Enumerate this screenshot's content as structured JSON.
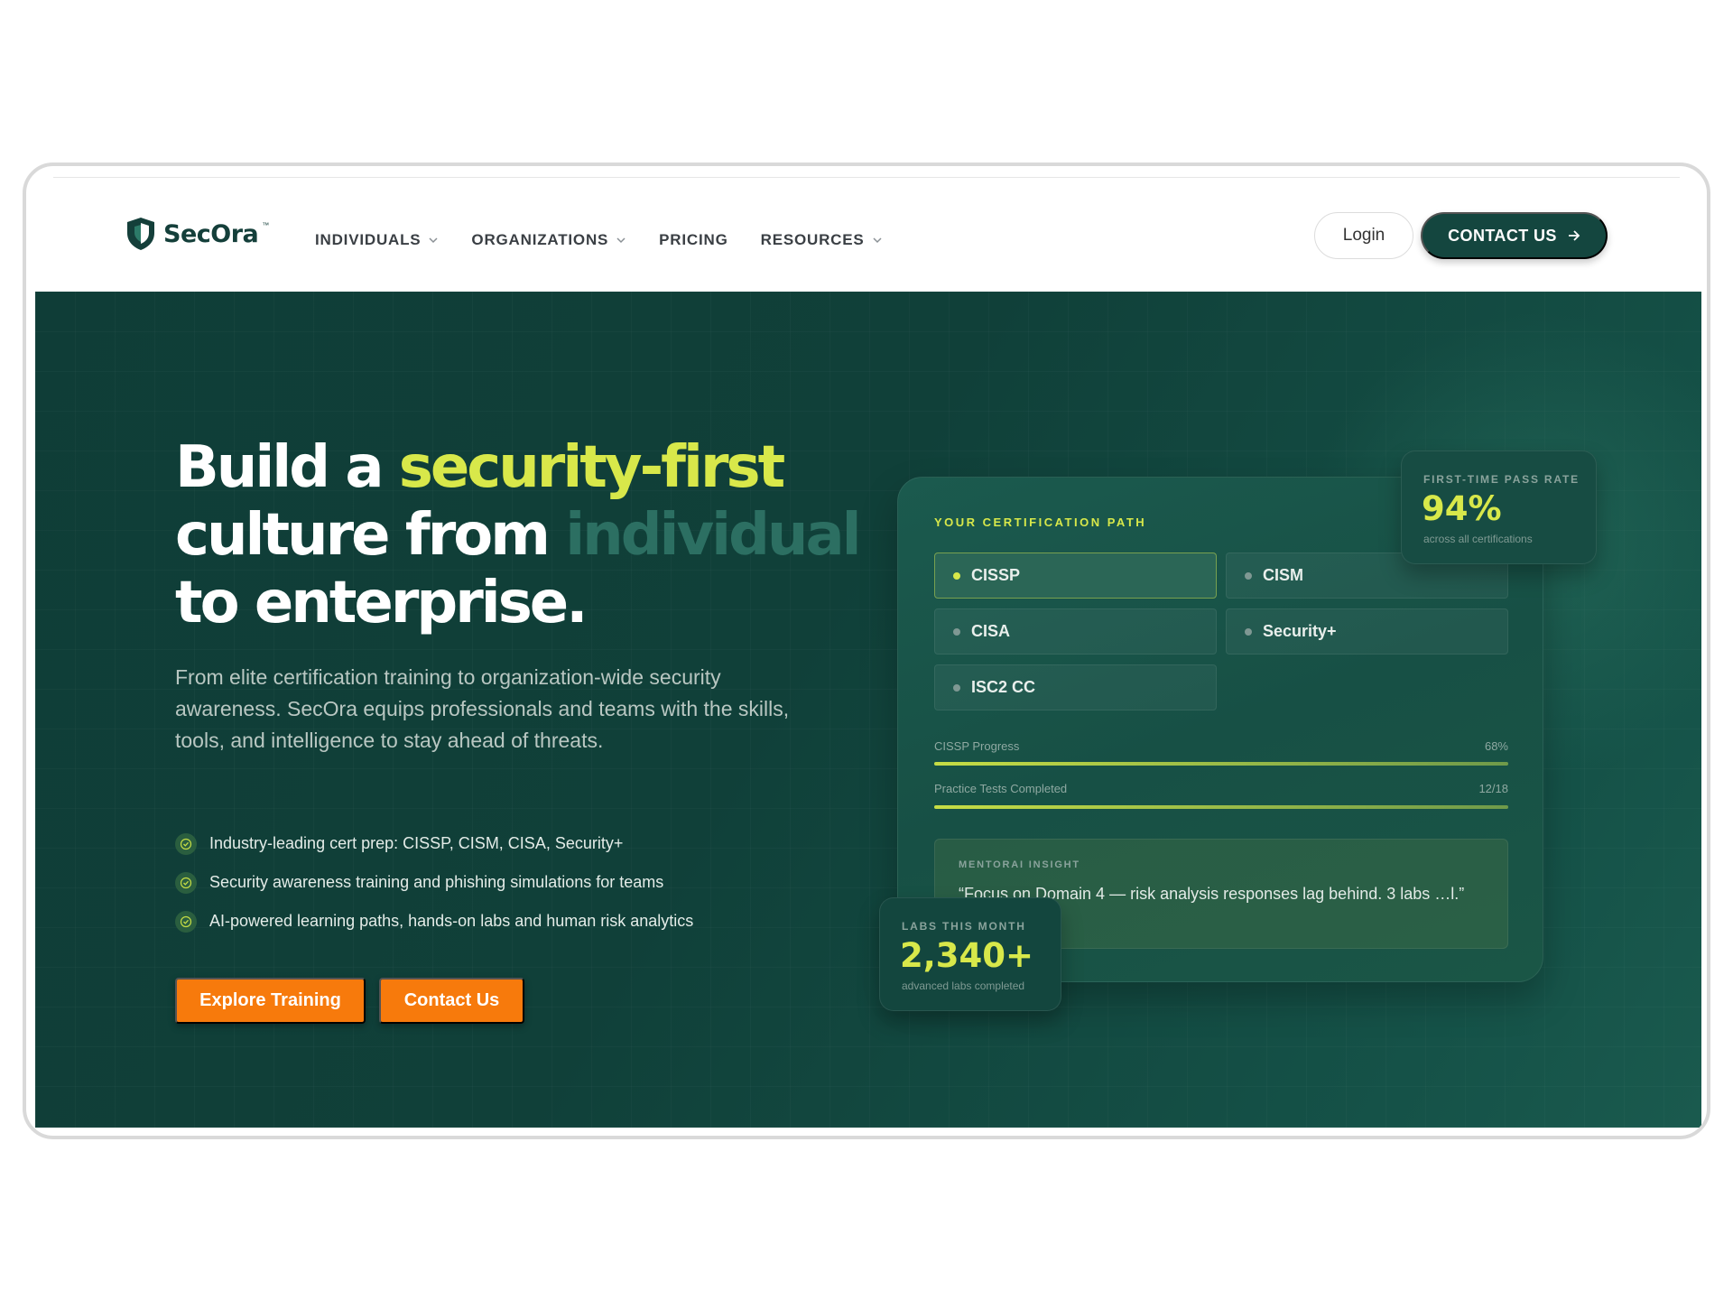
{
  "brand": {
    "name": "SecOra",
    "trademark": "™"
  },
  "nav": {
    "items": [
      {
        "label": "INDIVIDUALS",
        "has_dropdown": true
      },
      {
        "label": "ORGANIZATIONS",
        "has_dropdown": true
      },
      {
        "label": "PRICING",
        "has_dropdown": false
      },
      {
        "label": "RESOURCES",
        "has_dropdown": true
      }
    ],
    "login_label": "Login",
    "contact_label": "CONTACT US"
  },
  "hero": {
    "headline_part1": "Build a ",
    "headline_highlight": "security-first",
    "headline_part2": "culture from ",
    "headline_dim": "individual",
    "headline_part3": "to enterprise.",
    "subtitle": "From elite certification training to organization-wide security awareness. SecOra equips professionals and teams with the skills, tools, and intelligence to stay ahead of threats.",
    "features": [
      "Industry-leading cert prep: CISSP, CISM, CISA, Security+",
      "Security awareness training and phishing simulations for teams",
      "AI-powered learning paths, hands-on labs and human risk analytics"
    ],
    "cta_primary": "Explore Training",
    "cta_secondary": "Contact Us"
  },
  "dashboard": {
    "title": "YOUR CERTIFICATION PATH",
    "certs": [
      {
        "label": "CISSP",
        "active": true
      },
      {
        "label": "CISM",
        "active": false
      },
      {
        "label": "CISA",
        "active": false
      },
      {
        "label": "Security+",
        "active": false
      },
      {
        "label": "ISC2 CC",
        "active": false
      }
    ],
    "progress": [
      {
        "label": "CISSP Progress",
        "value_text": "68%",
        "fraction": 1.0
      },
      {
        "label": "Practice Tests Completed",
        "value_text": "12/18",
        "fraction": 1.0
      }
    ],
    "insight": {
      "label": "MENTORAI INSIGHT",
      "text": "“Focus on Domain 4 — risk analysis responses lag behind. 3 labs …l.”"
    }
  },
  "stats": {
    "pass_rate": {
      "label": "FIRST-TIME PASS RATE",
      "value": "94%",
      "caption": "across all certifications"
    },
    "labs": {
      "label": "LABS THIS MONTH",
      "value": "2,340+",
      "caption": "advanced labs completed"
    }
  },
  "colors": {
    "hero_bg": "#0f3d37",
    "accent_lime": "#d8e84a",
    "accent_orange": "#f77a0c",
    "brand_dark": "#14463f"
  }
}
